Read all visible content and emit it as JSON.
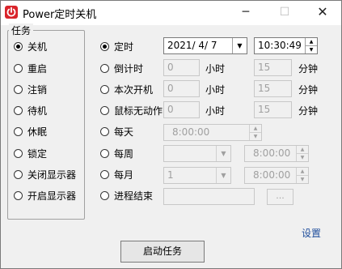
{
  "window": {
    "title": "Power定时关机",
    "min_icon": "─",
    "max_icon": "☐",
    "close_icon": "✕"
  },
  "tasks": {
    "title": "任务",
    "items": [
      {
        "label": "关机",
        "checked": true
      },
      {
        "label": "重启",
        "checked": false
      },
      {
        "label": "注销",
        "checked": false
      },
      {
        "label": "待机",
        "checked": false
      },
      {
        "label": "休眠",
        "checked": false
      },
      {
        "label": "锁定",
        "checked": false
      },
      {
        "label": "关闭显示器",
        "checked": false
      },
      {
        "label": "开启显示器",
        "checked": false
      }
    ]
  },
  "modes": {
    "timed": {
      "label": "定时",
      "checked": true,
      "date": "2021/  4/  7",
      "time": "10:30:49"
    },
    "countdown": {
      "label": "倒计时",
      "hours": "0",
      "hours_unit": "小时",
      "minutes": "15",
      "minutes_unit": "分钟"
    },
    "boot": {
      "label": "本次开机",
      "hours": "0",
      "hours_unit": "小时",
      "minutes": "15",
      "minutes_unit": "分钟"
    },
    "idle": {
      "label": "鼠标无动作",
      "hours": "0",
      "hours_unit": "小时",
      "minutes": "15",
      "minutes_unit": "分钟"
    },
    "daily": {
      "label": "每天",
      "time": "8:00:00"
    },
    "weekly": {
      "label": "每周",
      "day": "",
      "time": "8:00:00"
    },
    "monthly": {
      "label": "每月",
      "day": "1",
      "time": "8:00:00"
    },
    "process": {
      "label": "进程结束",
      "value": "",
      "browse": "..."
    }
  },
  "settings_label": "设置",
  "start_button": "启动任务",
  "colors": {
    "title_icon": "#d9242b",
    "link": "#1f4e9c"
  }
}
